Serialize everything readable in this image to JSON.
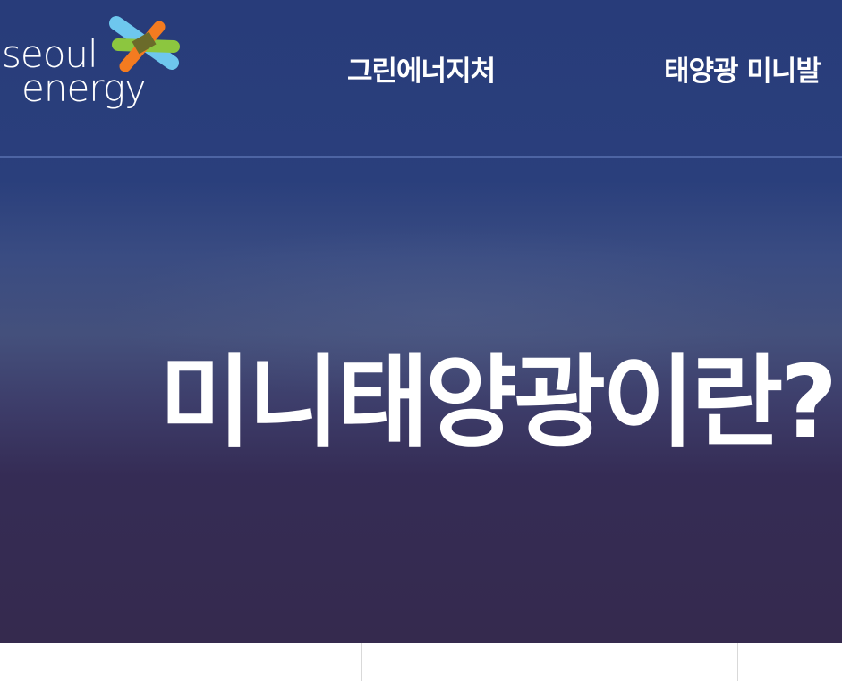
{
  "brand": {
    "logo_line1": "seoul",
    "logo_line2": "energy",
    "colors": {
      "blue": "#6ec7ee",
      "green": "#8cc63f",
      "orange": "#f47b20",
      "olive": "#6b6b2a"
    }
  },
  "nav": {
    "items": [
      {
        "label": "그린에너지처"
      },
      {
        "label": "태양광 미니발"
      }
    ]
  },
  "hero": {
    "title": "미니태양광이란?"
  },
  "colors": {
    "header_bg": "#283c7a",
    "hero_bottom": "#352a4e",
    "divider": "#4d64a3"
  }
}
